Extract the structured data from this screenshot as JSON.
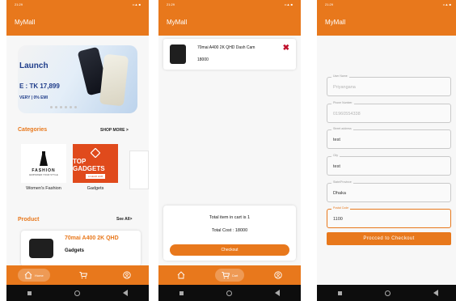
{
  "app_title": "MyMall",
  "status_time": "21:29",
  "status_icons": "••▲ ■",
  "colors": {
    "accent": "#e8781c",
    "delete": "#c0122d"
  },
  "home": {
    "banner": {
      "line1": "Launch",
      "line2": "E : TK 17,899",
      "line3": "VERY | 0% EMI"
    },
    "categories_title": "Categories",
    "shop_more": "SHOP MORE >",
    "categories": [
      {
        "label": "Women's Fashion",
        "image_text": "FASHION",
        "image_subtext": "EMPOWER YOUR STYLE"
      },
      {
        "label": "Gadgets",
        "image_text": "TOP GADGETS",
        "image_subtext": "A GEAR HUB"
      }
    ],
    "product_title": "Product",
    "see_all": "See All>",
    "product": {
      "name": "70mai A400 2K QHD",
      "category": "Gadgets"
    }
  },
  "cart": {
    "item": {
      "name": "70mai A400 2K QHD Dash Cam",
      "price": "18000",
      "delete_icon": "✖"
    },
    "total_items": "Total item in cart is 1",
    "total_cost": "Total Cost : 18000",
    "checkout": "Checkout"
  },
  "checkout_form": {
    "fields": [
      {
        "label": "User Name",
        "value": "Priyangana",
        "placeholder": true
      },
      {
        "label": "Phone Number",
        "value": "01960554338",
        "placeholder": true
      },
      {
        "label": "Street address",
        "value": "test",
        "placeholder": false
      },
      {
        "label": "City",
        "value": "test",
        "placeholder": false
      },
      {
        "label": "State/Province",
        "value": "Dhaka",
        "placeholder": false
      },
      {
        "label": "Postal Code",
        "value": "1100",
        "placeholder": false
      }
    ],
    "submit": "Procced to Checkout"
  },
  "bottom_nav": {
    "home": "Home",
    "cart": "Cart"
  }
}
